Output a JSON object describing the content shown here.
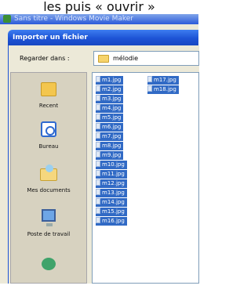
{
  "caption": {
    "text": "les puis « ouvrir »"
  },
  "main_window": {
    "title": "Sans titre - Windows Movie Maker"
  },
  "dialog": {
    "title": "Importer un fichier",
    "lookin_label": "Regarder dans :",
    "lookin_value": "mélodie",
    "places": [
      {
        "label": "Recent",
        "icon": "recent-folder-icon"
      },
      {
        "label": "Bureau",
        "icon": "desktop-icon"
      },
      {
        "label": "Mes documents",
        "icon": "my-documents-icon"
      },
      {
        "label": "Poste de travail",
        "icon": "my-computer-icon"
      },
      {
        "label": "",
        "icon": "network-icon"
      }
    ],
    "files_col1": [
      "m1.jpg",
      "m2.jpg",
      "m3.jpg",
      "m4.jpg",
      "m5.jpg",
      "m6.jpg",
      "m7.jpg",
      "m8.jpg",
      "m9.jpg",
      "m10.jpg",
      "m11.jpg",
      "m12.jpg",
      "m13.jpg",
      "m14.jpg",
      "m15.jpg",
      "m16.jpg"
    ],
    "files_col2": [
      "m17.jpg",
      "m18.jpg"
    ],
    "selection_color": "#316ac5"
  }
}
